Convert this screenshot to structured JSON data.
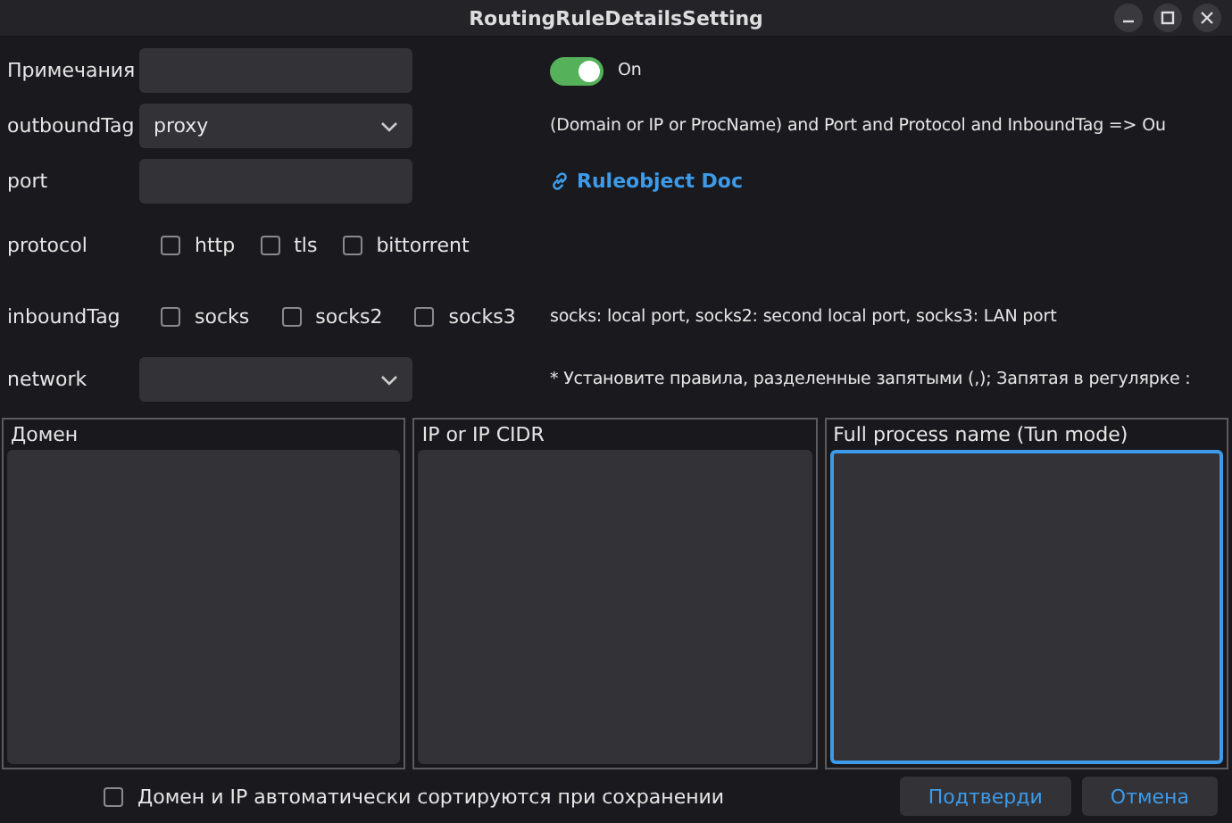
{
  "window": {
    "title": "RoutingRuleDetailsSetting"
  },
  "form": {
    "remarks": {
      "label": "Примечания"
    },
    "outbound_tag": {
      "label": "outboundTag",
      "value": "proxy"
    },
    "port": {
      "label": "port"
    },
    "protocol": {
      "label": "protocol",
      "options": [
        {
          "label": "http",
          "checked": false
        },
        {
          "label": "tls",
          "checked": false
        },
        {
          "label": "bittorrent",
          "checked": false
        }
      ]
    },
    "inbound_tag": {
      "label": "inboundTag",
      "options": [
        {
          "label": "socks",
          "checked": false
        },
        {
          "label": "socks2",
          "checked": false
        },
        {
          "label": "socks3",
          "checked": false
        }
      ]
    },
    "network": {
      "label": "network"
    }
  },
  "enabled": {
    "on": true,
    "label": "On"
  },
  "info": {
    "rule_hint": "(Domain or IP or ProcName) and Port and Protocol and InboundTag => Ou",
    "doc_link": "Ruleobject Doc",
    "inbound_hint": "socks: local port, socks2: second local port, socks3: LAN port",
    "separator_hint": "* Установите правила, разделенные запятыми (,); Запятая в регулярке :"
  },
  "panels": [
    {
      "title": "Домен",
      "focused": false
    },
    {
      "title": "IP or IP CIDR",
      "focused": false
    },
    {
      "title": "Full process name (Tun mode)",
      "focused": true
    }
  ],
  "footer": {
    "auto_sort": {
      "label": "Домен и IP автоматически сортируются при сохранении",
      "checked": false
    },
    "buttons": [
      "Подтверди",
      "Отмена"
    ]
  }
}
